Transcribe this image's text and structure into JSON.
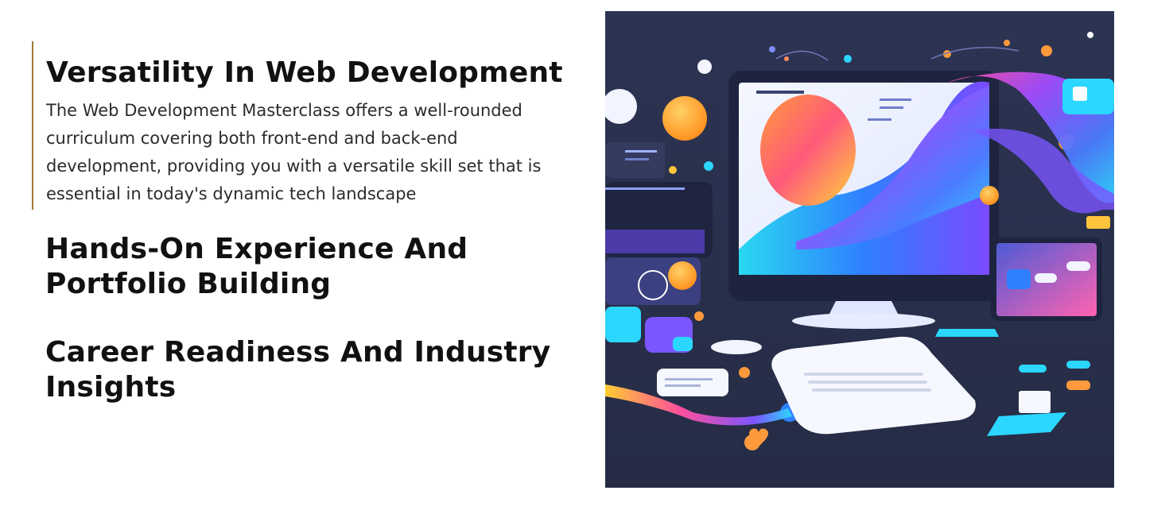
{
  "sections": [
    {
      "title": "Versatility In Web Development",
      "body": "The Web Development Masterclass offers a well-rounded curriculum covering both front-end and back-end development, providing you with a versatile skill set that is essential in today's dynamic tech landscape",
      "expanded": true
    },
    {
      "title": "Hands-On Experience And Portfolio Building",
      "expanded": false
    },
    {
      "title": "Career Readiness And Industry Insights",
      "expanded": false
    }
  ],
  "hero_image": {
    "subject": "web-development-illustration"
  },
  "colors": {
    "accent_border": "#a07a36",
    "illustration_background": "#2e3551"
  }
}
